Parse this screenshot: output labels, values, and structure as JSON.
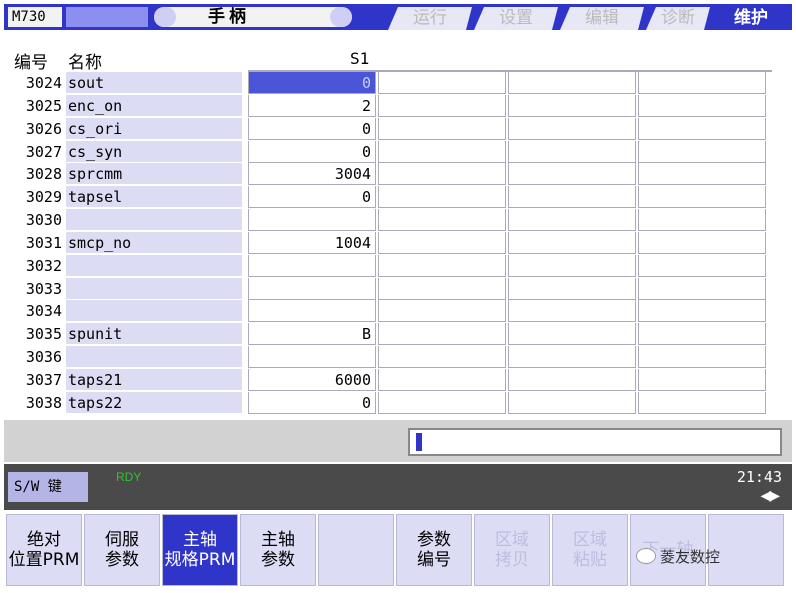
{
  "header": {
    "model": "M730",
    "mode": "手柄",
    "tabs": [
      "运行",
      "设置",
      "编辑",
      "诊断",
      "维护"
    ],
    "active_tab": "维护"
  },
  "table": {
    "col_number": "编号",
    "col_name": "名称",
    "col_value": "S1",
    "rows": [
      {
        "number": "3024",
        "name": "sout",
        "value": "0"
      },
      {
        "number": "3025",
        "name": "enc_on",
        "value": "2"
      },
      {
        "number": "3026",
        "name": "cs_ori",
        "value": "0"
      },
      {
        "number": "3027",
        "name": "cs_syn",
        "value": "0"
      },
      {
        "number": "3028",
        "name": "sprcmm",
        "value": "3004"
      },
      {
        "number": "3029",
        "name": "tapsel",
        "value": "0"
      },
      {
        "number": "3030",
        "name": "",
        "value": ""
      },
      {
        "number": "3031",
        "name": "smcp_no",
        "value": "1004"
      },
      {
        "number": "3032",
        "name": "",
        "value": ""
      },
      {
        "number": "3033",
        "name": "",
        "value": ""
      },
      {
        "number": "3034",
        "name": "",
        "value": ""
      },
      {
        "number": "3035",
        "name": "spunit",
        "value": "B"
      },
      {
        "number": "3036",
        "name": "",
        "value": ""
      },
      {
        "number": "3037",
        "name": "taps21",
        "value": "6000"
      },
      {
        "number": "3038",
        "name": "taps22",
        "value": "0"
      }
    ]
  },
  "status": {
    "sw_key": "S/W 键",
    "ready": "RDY",
    "time": "21:43",
    "page_arrows": "◀▶"
  },
  "softkeys": [
    {
      "line1": "绝对",
      "line2": "位置PRM",
      "state": "normal"
    },
    {
      "line1": "伺服",
      "line2": "参数",
      "state": "normal"
    },
    {
      "line1": "主轴",
      "line2": "规格PRM",
      "state": "active"
    },
    {
      "line1": "主轴",
      "line2": "参数",
      "state": "normal"
    },
    {
      "line1": "",
      "line2": "",
      "state": "normal"
    },
    {
      "line1": "参数",
      "line2": "编号",
      "state": "normal"
    },
    {
      "line1": "区域",
      "line2": "拷贝",
      "state": "disabled"
    },
    {
      "line1": "区域",
      "line2": "粘贴",
      "state": "disabled"
    },
    {
      "line1": "下一轴",
      "line2": "",
      "state": "disabled"
    },
    {
      "line1": "",
      "line2": "",
      "state": "normal"
    }
  ],
  "watermark": "菱友数控",
  "colors": {
    "accent": "#2f35c8",
    "label_bg": "#dcdcf4",
    "ready": "#28c828"
  }
}
